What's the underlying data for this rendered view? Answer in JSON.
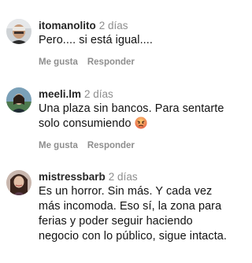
{
  "comments": [
    {
      "username": "itomanolito",
      "time": "2 días",
      "text": "Pero.... si está igual....",
      "like_label": "Me gusta",
      "reply_label": "Responder"
    },
    {
      "username": "meeli.lm",
      "time": "2 días",
      "text": "Una plaza sin bancos. Para sentarte solo consumiendo",
      "emoji": "pouting-face-icon",
      "like_label": "Me gusta",
      "reply_label": "Responder"
    },
    {
      "username": "mistressbarb",
      "time": "2 días",
      "text": "Es un horror. Sin más. Y cada vez más incomoda. Eso sí, la zona para ferias y poder seguir haciendo negocio con lo público, sigue intacta."
    }
  ],
  "colors": {
    "username": "#262626",
    "secondary_text": "#8e8e8e",
    "body_text": "#111111"
  }
}
